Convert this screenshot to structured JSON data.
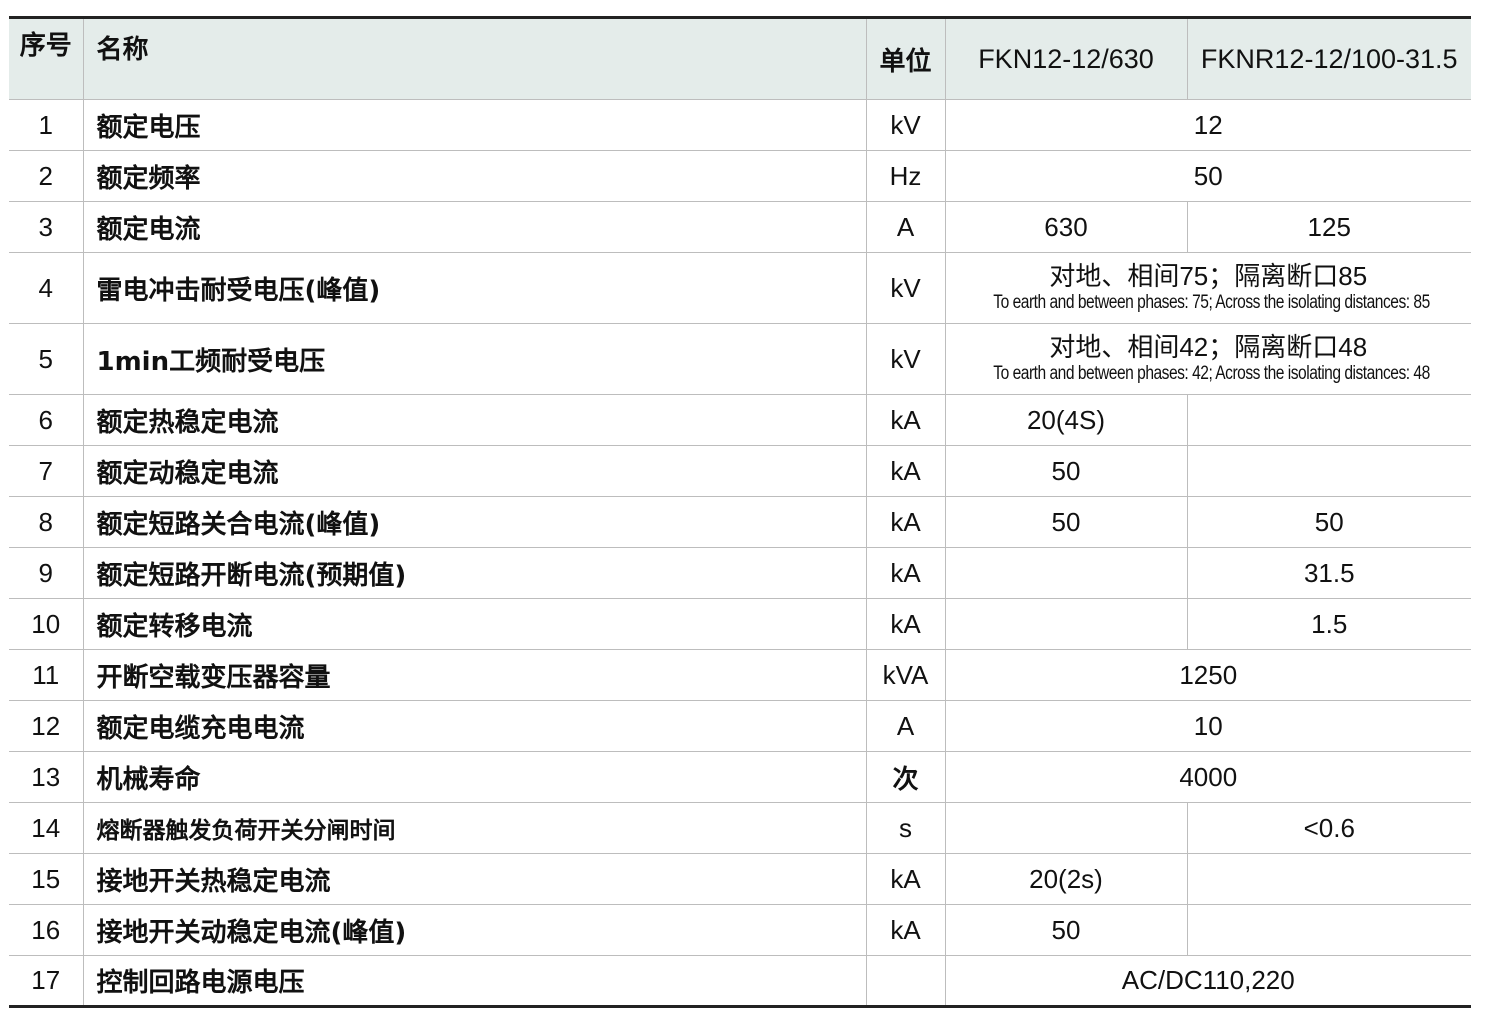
{
  "header": {
    "num": "序号",
    "name": "名称",
    "unit": "单位",
    "model_a": "FKN12-12/630",
    "model_b": "FKNR12-12/100-31.5"
  },
  "rows": [
    {
      "num": "1",
      "name": "额定电压",
      "unit": "kV",
      "merged": "12"
    },
    {
      "num": "2",
      "name": "额定频率",
      "unit": "Hz",
      "merged": "50"
    },
    {
      "num": "3",
      "name": "额定电流",
      "unit": "A",
      "a": "630",
      "b": "125"
    },
    {
      "num": "4",
      "name": "雷电冲击耐受电压(峰值)",
      "unit": "kV",
      "merged_cn": "对地、相间75；隔离断口85",
      "merged_en": "To earth and between phases: 75; Across the isolating distances: 85"
    },
    {
      "num": "5",
      "name": "1min工频耐受电压",
      "unit": "kV",
      "merged_cn": "对地、相间42；隔离断口48",
      "merged_en": "To earth and between phases: 42; Across the isolating distances: 48"
    },
    {
      "num": "6",
      "name": "额定热稳定电流",
      "unit": "kA",
      "a": "20(4S)",
      "b": ""
    },
    {
      "num": "7",
      "name": "额定动稳定电流",
      "unit": "kA",
      "a": "50",
      "b": ""
    },
    {
      "num": "8",
      "name": "额定短路关合电流(峰值)",
      "unit": "kA",
      "a": "50",
      "b": "50"
    },
    {
      "num": "9",
      "name": "额定短路开断电流(预期值)",
      "unit": "kA",
      "a": "",
      "b": "31.5"
    },
    {
      "num": "10",
      "name": "额定转移电流",
      "unit": "kA",
      "a": "",
      "b": "1.5"
    },
    {
      "num": "11",
      "name": "开断空载变压器容量",
      "unit": "kVA",
      "merged": "1250"
    },
    {
      "num": "12",
      "name": "额定电缆充电电流",
      "unit": "A",
      "merged": "10"
    },
    {
      "num": "13",
      "name": "机械寿命",
      "unit": "次",
      "merged": "4000"
    },
    {
      "num": "14",
      "name": "熔断器触发负荷开关分闸时间",
      "unit": "s",
      "a": "",
      "b": "<0.6"
    },
    {
      "num": "15",
      "name": "接地开关热稳定电流",
      "unit": "kA",
      "a": "20(2s)",
      "b": ""
    },
    {
      "num": "16",
      "name": "接地开关动稳定电流(峰值)",
      "unit": "kA",
      "a": "50",
      "b": ""
    },
    {
      "num": "17",
      "name": "控制回路电源电压",
      "unit": "",
      "merged": "AC/DC110,220"
    }
  ],
  "colors": {
    "header_bg": "#e4ecea",
    "rule": "#222222",
    "grid": "#bdbdbd"
  }
}
